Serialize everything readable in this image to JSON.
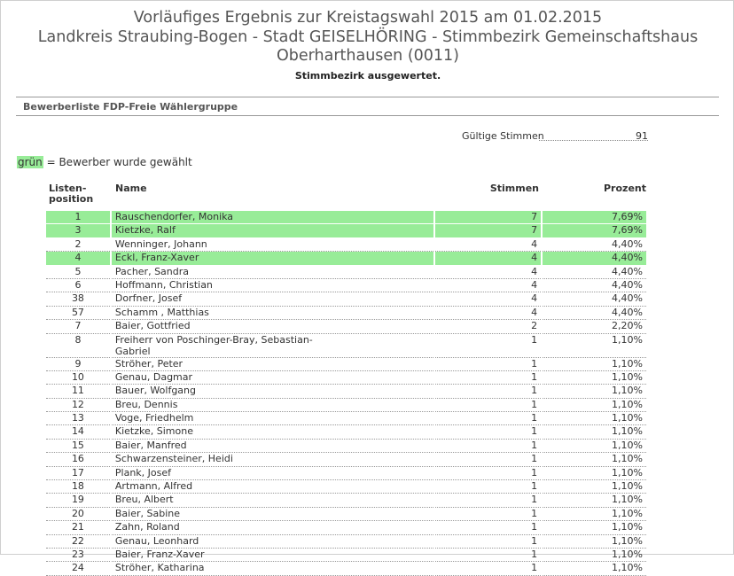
{
  "header": {
    "title_line1": "Vorläufiges Ergebnis zur Kreistagswahl 2015 am 01.02.2015",
    "title_line2": "Landkreis Straubing-Bogen - Stadt GEISELHÖRING - Stimmbezirk Gemeinschaftshaus",
    "title_line3": "Oberharthausen (0011)",
    "status": "Stimmbezirk ausgewertet."
  },
  "section": {
    "title": "Bewerberliste FDP-Freie Wählergruppe"
  },
  "summary": {
    "valid_votes_label": "Gültige Stimmen",
    "valid_votes_value": "91"
  },
  "legend": {
    "highlight": "grün",
    "text": " = Bewerber wurde gewählt",
    "color": "#98ec98"
  },
  "table": {
    "columns": {
      "position_line1": "Listen-",
      "position_line2": "position",
      "name": "Name",
      "votes": "Stimmen",
      "percent": "Prozent"
    },
    "rows": [
      {
        "pos": "1",
        "name": "Rauschendorfer, Monika",
        "name2": "",
        "votes": "7",
        "pct": "7,69%",
        "elected": true
      },
      {
        "pos": "3",
        "name": "Kietzke, Ralf",
        "name2": "",
        "votes": "7",
        "pct": "7,69%",
        "elected": true
      },
      {
        "pos": "2",
        "name": "Wenninger, Johann",
        "name2": "",
        "votes": "4",
        "pct": "4,40%",
        "elected": false
      },
      {
        "pos": "4",
        "name": "Eckl, Franz-Xaver",
        "name2": "",
        "votes": "4",
        "pct": "4,40%",
        "elected": true
      },
      {
        "pos": "5",
        "name": "Pacher, Sandra",
        "name2": "",
        "votes": "4",
        "pct": "4,40%",
        "elected": false
      },
      {
        "pos": "6",
        "name": "Hoffmann, Christian",
        "name2": "",
        "votes": "4",
        "pct": "4,40%",
        "elected": false
      },
      {
        "pos": "38",
        "name": "Dorfner, Josef",
        "name2": "",
        "votes": "4",
        "pct": "4,40%",
        "elected": false
      },
      {
        "pos": "57",
        "name": "Schamm , Matthias",
        "name2": "",
        "votes": "4",
        "pct": "4,40%",
        "elected": false
      },
      {
        "pos": "7",
        "name": "Baier, Gottfried",
        "name2": "",
        "votes": "2",
        "pct": "2,20%",
        "elected": false
      },
      {
        "pos": "8",
        "name": "Freiherr von Poschinger-Bray, Sebastian-",
        "name2": "Gabriel",
        "votes": "1",
        "pct": "1,10%",
        "elected": false
      },
      {
        "pos": "9",
        "name": "Ströher, Peter",
        "name2": "",
        "votes": "1",
        "pct": "1,10%",
        "elected": false
      },
      {
        "pos": "10",
        "name": "Genau, Dagmar",
        "name2": "",
        "votes": "1",
        "pct": "1,10%",
        "elected": false
      },
      {
        "pos": "11",
        "name": "Bauer, Wolfgang",
        "name2": "",
        "votes": "1",
        "pct": "1,10%",
        "elected": false
      },
      {
        "pos": "12",
        "name": "Breu, Dennis",
        "name2": "",
        "votes": "1",
        "pct": "1,10%",
        "elected": false
      },
      {
        "pos": "13",
        "name": "Voge, Friedhelm",
        "name2": "",
        "votes": "1",
        "pct": "1,10%",
        "elected": false
      },
      {
        "pos": "14",
        "name": "Kietzke, Simone",
        "name2": "",
        "votes": "1",
        "pct": "1,10%",
        "elected": false
      },
      {
        "pos": "15",
        "name": "Baier, Manfred",
        "name2": "",
        "votes": "1",
        "pct": "1,10%",
        "elected": false
      },
      {
        "pos": "16",
        "name": "Schwarzensteiner, Heidi",
        "name2": "",
        "votes": "1",
        "pct": "1,10%",
        "elected": false
      },
      {
        "pos": "17",
        "name": "Plank, Josef",
        "name2": "",
        "votes": "1",
        "pct": "1,10%",
        "elected": false
      },
      {
        "pos": "18",
        "name": "Artmann, Alfred",
        "name2": "",
        "votes": "1",
        "pct": "1,10%",
        "elected": false
      },
      {
        "pos": "19",
        "name": "Breu, Albert",
        "name2": "",
        "votes": "1",
        "pct": "1,10%",
        "elected": false
      },
      {
        "pos": "20",
        "name": "Baier, Sabine",
        "name2": "",
        "votes": "1",
        "pct": "1,10%",
        "elected": false
      },
      {
        "pos": "21",
        "name": "Zahn, Roland",
        "name2": "",
        "votes": "1",
        "pct": "1,10%",
        "elected": false
      },
      {
        "pos": "22",
        "name": "Genau, Leonhard",
        "name2": "",
        "votes": "1",
        "pct": "1,10%",
        "elected": false
      },
      {
        "pos": "23",
        "name": "Baier, Franz-Xaver",
        "name2": "",
        "votes": "1",
        "pct": "1,10%",
        "elected": false
      },
      {
        "pos": "24",
        "name": "Ströher, Katharina",
        "name2": "",
        "votes": "1",
        "pct": "1,10%",
        "elected": false
      }
    ]
  }
}
